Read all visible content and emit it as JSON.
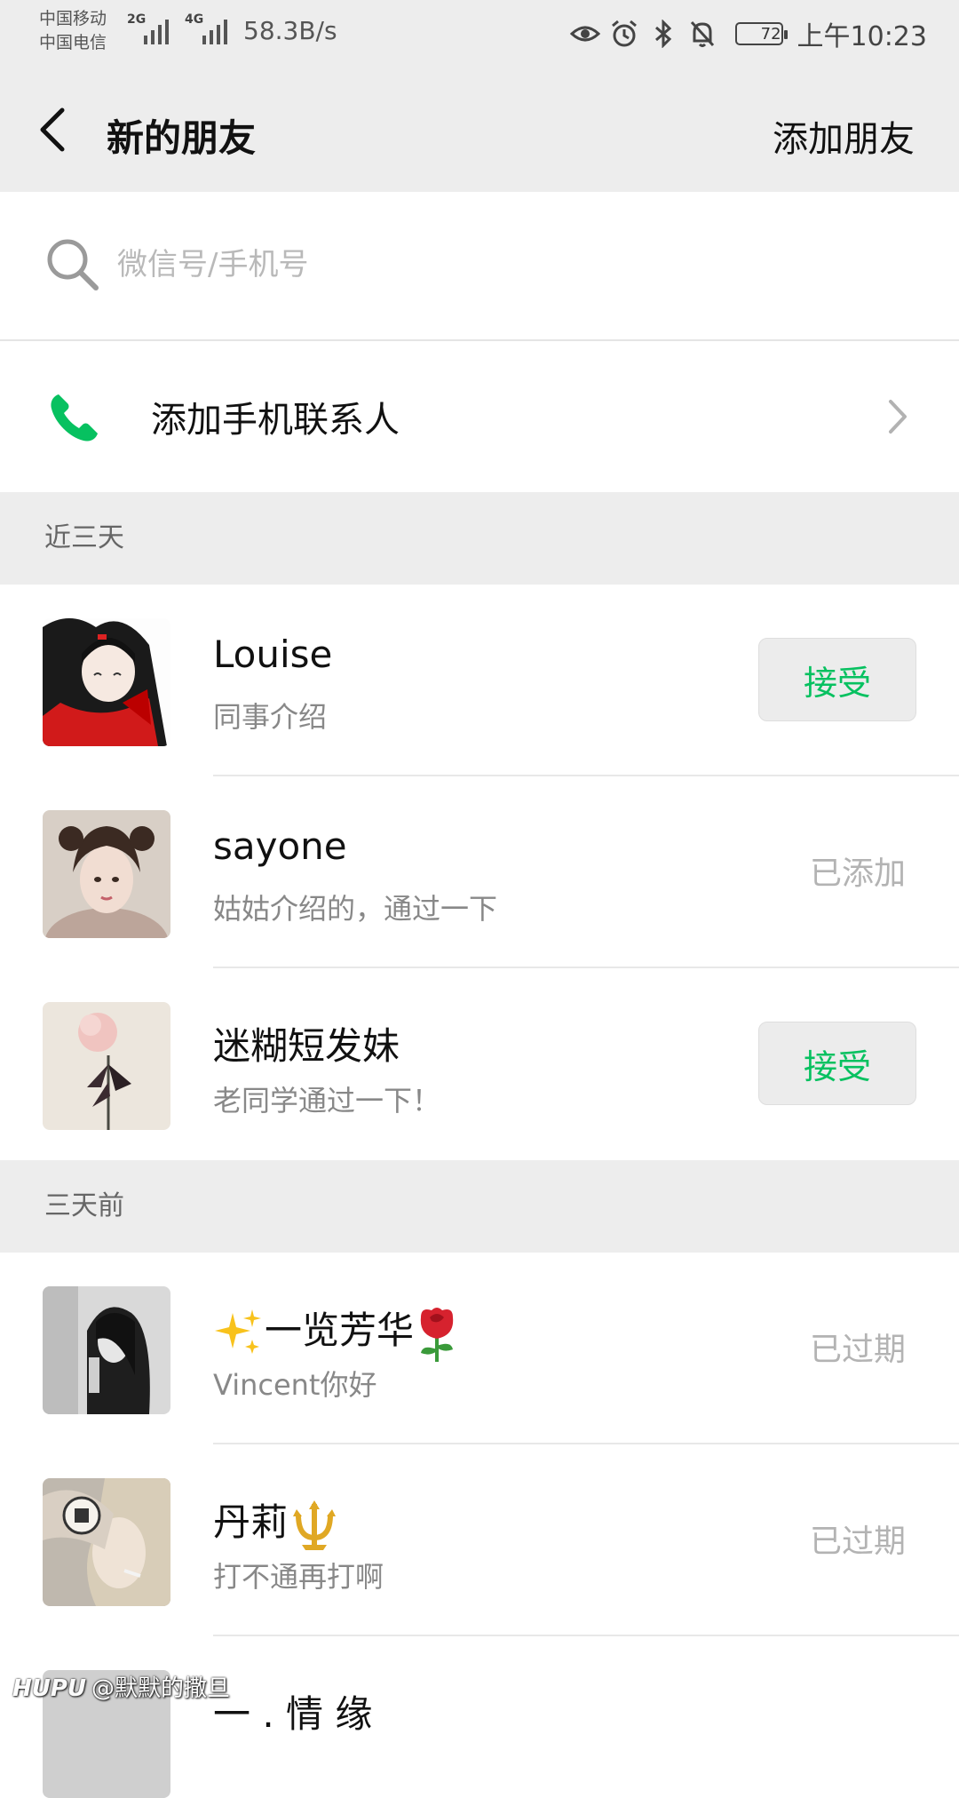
{
  "status": {
    "carrier1": "中国移动",
    "carrier2": "中国电信",
    "net1": "2G",
    "net2": "4G",
    "speed": "58.3B/s",
    "battery": "72",
    "battery_level": 0.72,
    "time": "上午10:23",
    "icons": [
      "eye-icon",
      "alarm-icon",
      "bluetooth-icon",
      "bell-off-icon",
      "battery-icon"
    ]
  },
  "nav": {
    "title": "新的朋友",
    "action": "添加朋友"
  },
  "search": {
    "placeholder": "微信号/手机号"
  },
  "add_contacts": {
    "label": "添加手机联系人"
  },
  "sections": {
    "recent": "近三天",
    "earlier": "三天前"
  },
  "requests": [
    {
      "name": "Louise",
      "message": "同事介绍",
      "action": "接受"
    },
    {
      "name": "sayone",
      "message": "姑姑介绍的，通过一下",
      "status": "已添加"
    },
    {
      "name": "迷糊短发妹",
      "message": "老同学通过一下！",
      "action": "接受"
    },
    {
      "name": "一览芳华",
      "message": "Vincent你好",
      "status": "已过期"
    },
    {
      "name": "丹莉",
      "message": "打不通再打啊",
      "status": "已过期"
    },
    {
      "name": "一 . 情 缘"
    }
  ],
  "watermark": {
    "brand": "HUPU",
    "user": "@默默的撒旦"
  },
  "colors": {
    "accent": "#07c160",
    "background": "#ededed"
  }
}
